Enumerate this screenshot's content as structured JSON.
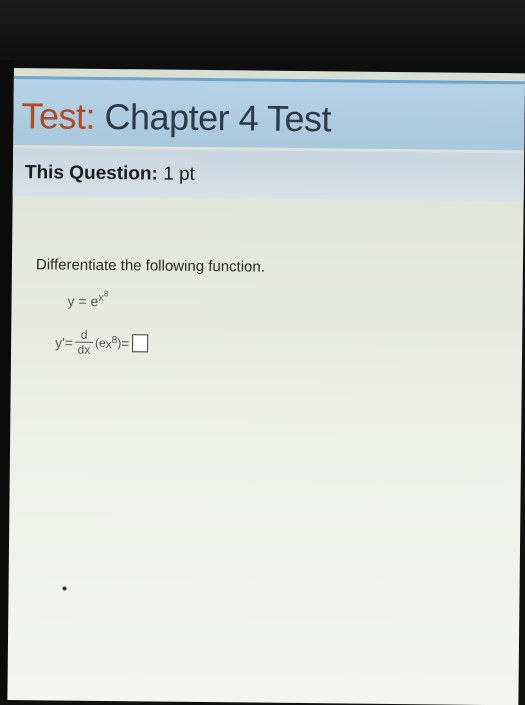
{
  "header": {
    "prefix": "Test:",
    "title": "Chapter 4 Test"
  },
  "question_bar": {
    "label": "This Question:",
    "points": "1 pt"
  },
  "question": {
    "instruction": "Differentiate the following function.",
    "function": {
      "lhs": "y",
      "eq": "=",
      "base": "e",
      "exp_base": "x",
      "exp_power": "8"
    },
    "derivative": {
      "lhs": "y'",
      "eq": "=",
      "numerator": "d",
      "denominator": "dx",
      "open": "(e",
      "exp_base": "x",
      "exp_power": "8",
      "close": ")",
      "eq2": "="
    },
    "answer_value": ""
  }
}
